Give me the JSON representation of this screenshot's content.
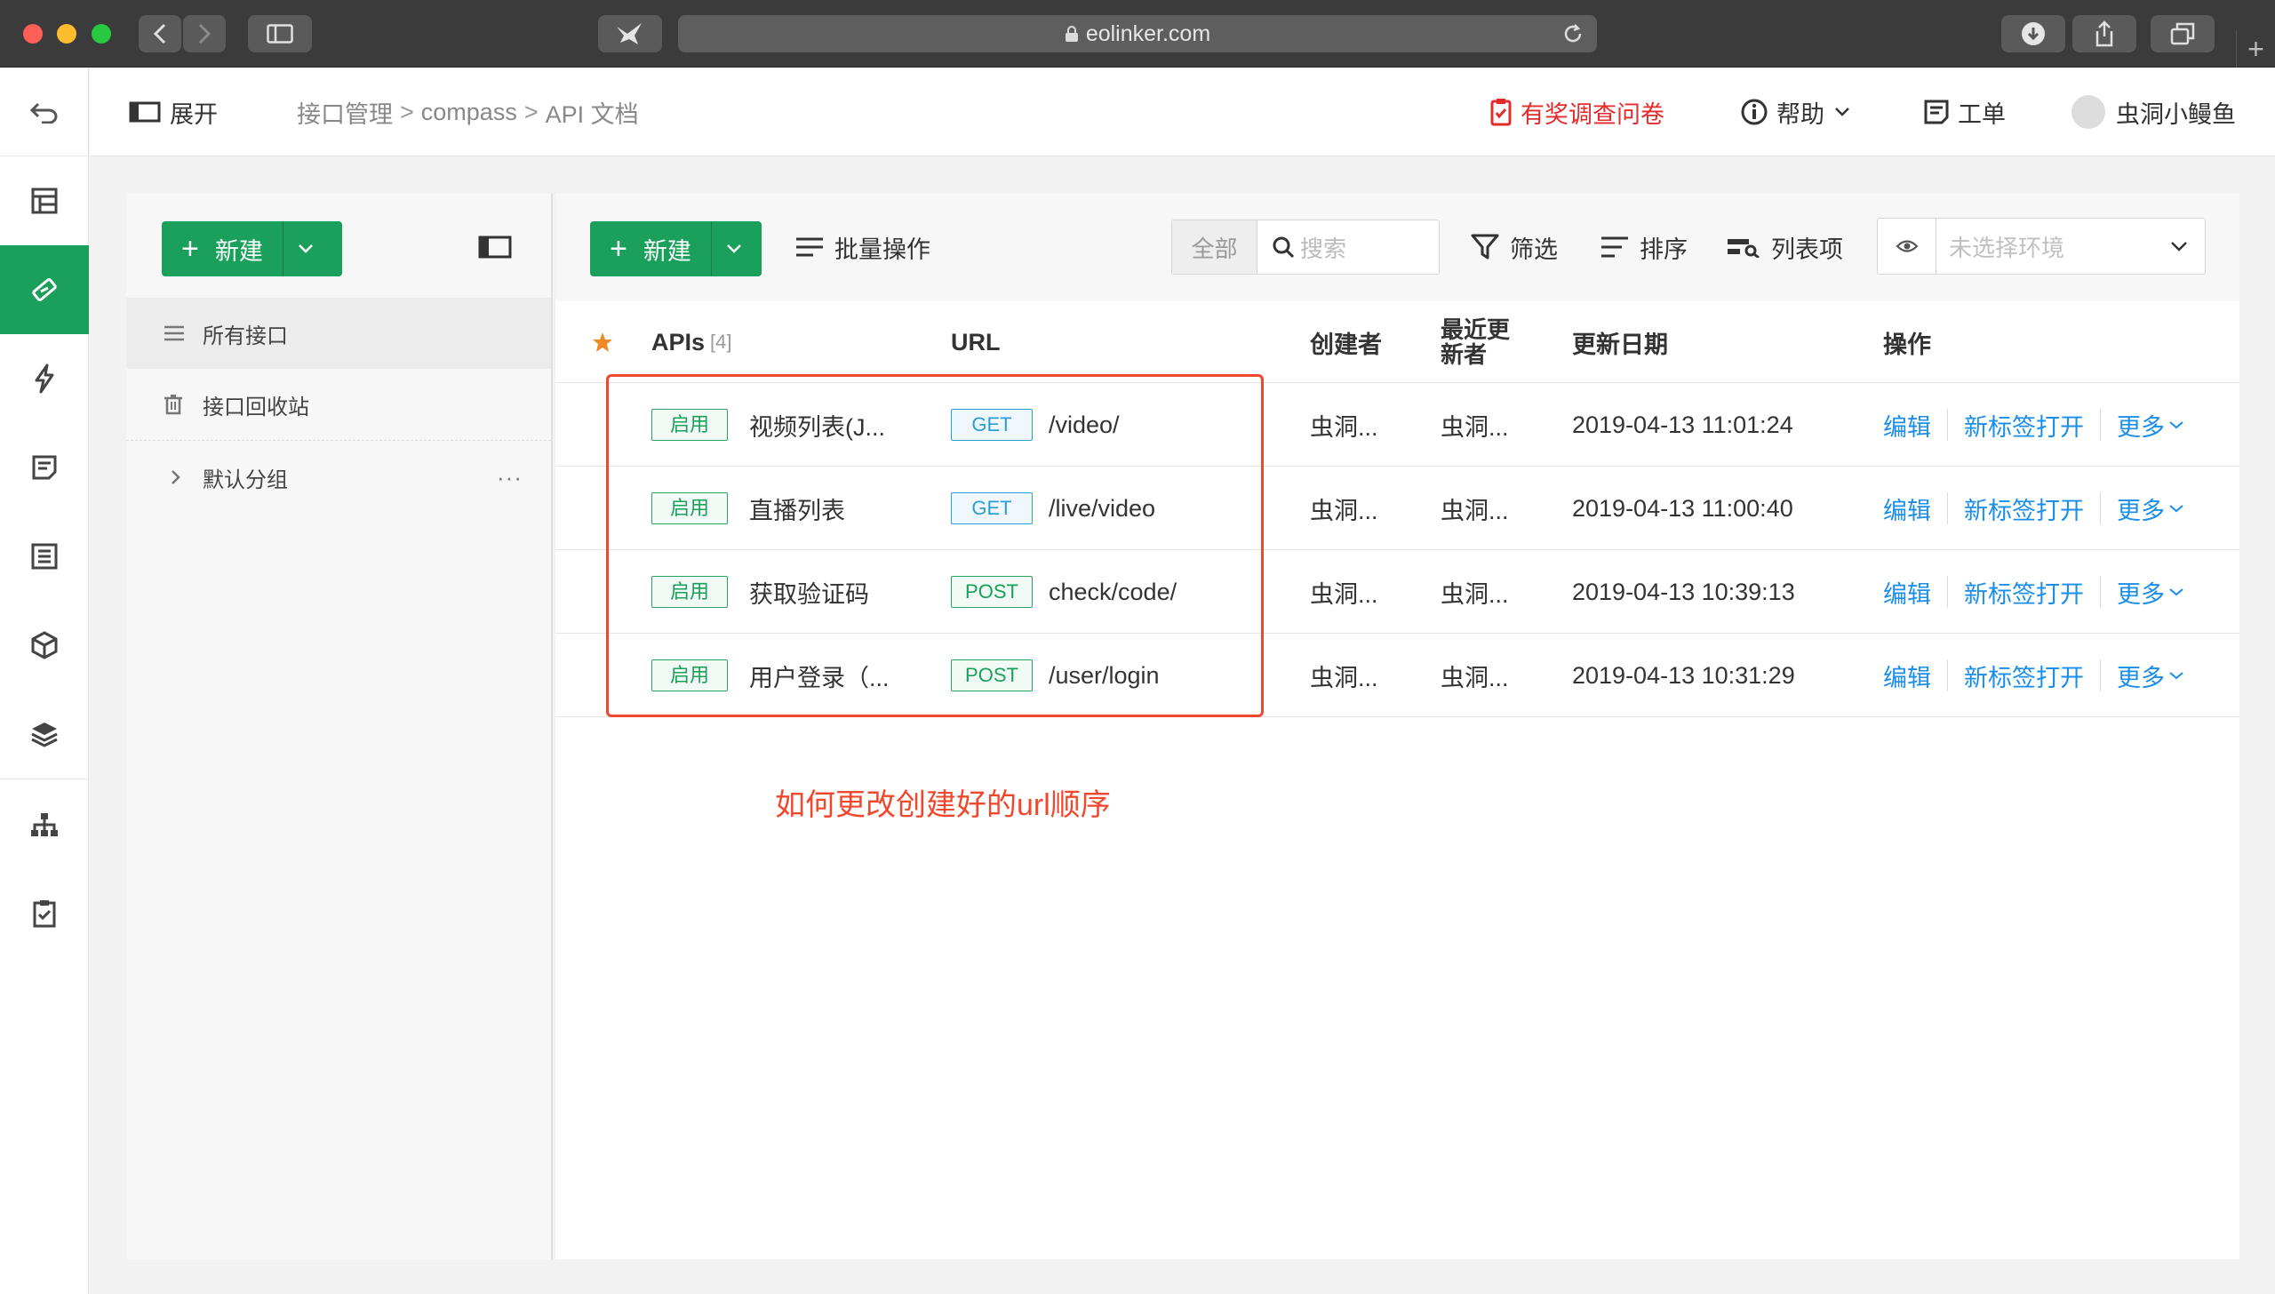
{
  "browser": {
    "url": "eolinker.com"
  },
  "header": {
    "expand_label": "展开",
    "breadcrumb": [
      "接口管理",
      "compass",
      "API 文档"
    ],
    "survey_label": "有奖调查问卷",
    "help_label": "帮助",
    "ticket_label": "工单",
    "user_name": "虫洞小鳗鱼"
  },
  "sidebar_icons": [
    "dashboard-icon",
    "api-icon",
    "lightning-icon",
    "doc-icon",
    "list-icon",
    "box-icon",
    "layers-icon",
    "org-chart-icon",
    "clipboard-icon"
  ],
  "left_panel": {
    "new_label": "新建",
    "items": [
      {
        "label": "所有接口"
      },
      {
        "label": "接口回收站"
      },
      {
        "label": "默认分组",
        "more": "···"
      }
    ]
  },
  "toolbar": {
    "new_label": "新建",
    "batch_label": "批量操作",
    "search_scope": "全部",
    "search_placeholder": "搜索",
    "filter_label": "筛选",
    "sort_label": "排序",
    "columns_label": "列表项",
    "env_placeholder": "未选择环境"
  },
  "table": {
    "headers": {
      "apis": "APIs",
      "apis_count": "[4]",
      "url": "URL",
      "creator": "创建者",
      "last_updater_line1": "最近更",
      "last_updater_line2": "新者",
      "updated": "更新日期",
      "ops": "操作"
    },
    "rows": [
      {
        "status": "启用",
        "name": "视频列表(J...",
        "method": "GET",
        "url": "/video/",
        "creator": "虫洞...",
        "updater": "虫洞...",
        "date": "2019-04-13 11:01:24",
        "edit": "编辑",
        "open": "新标签打开",
        "more": "更多"
      },
      {
        "status": "启用",
        "name": "直播列表",
        "method": "GET",
        "url": "/live/video",
        "creator": "虫洞...",
        "updater": "虫洞...",
        "date": "2019-04-13 11:00:40",
        "edit": "编辑",
        "open": "新标签打开",
        "more": "更多"
      },
      {
        "status": "启用",
        "name": "获取验证码",
        "method": "POST",
        "url": "check/code/",
        "creator": "虫洞...",
        "updater": "虫洞...",
        "date": "2019-04-13 10:39:13",
        "edit": "编辑",
        "open": "新标签打开",
        "more": "更多"
      },
      {
        "status": "启用",
        "name": "用户登录（...",
        "method": "POST",
        "url": "/user/login",
        "creator": "虫洞...",
        "updater": "虫洞...",
        "date": "2019-04-13 10:31:29",
        "edit": "编辑",
        "open": "新标签打开",
        "more": "更多"
      }
    ]
  },
  "annotation": {
    "text": "如何更改创建好的url顺序",
    "color": "#f0482c"
  },
  "colors": {
    "brand_green": "#1aa05a",
    "link_blue": "#1a8ee8",
    "survey_red": "#e32b2b"
  }
}
